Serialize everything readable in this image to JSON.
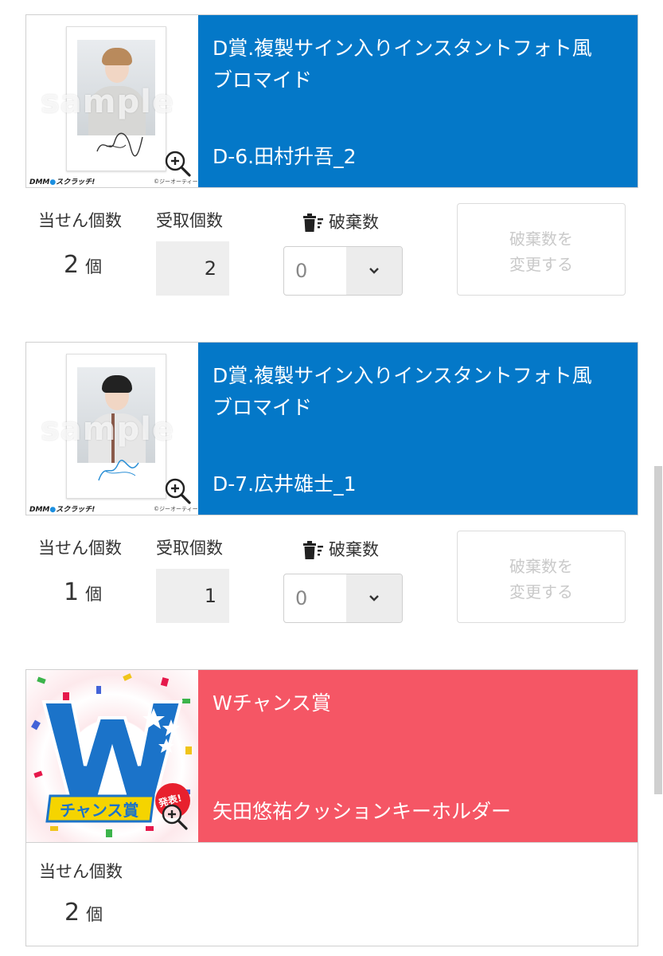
{
  "prizes": [
    {
      "title": "D賞.複製サイン入りインスタントフォト風\nブロマイド",
      "item": "D-6.田村升吾_2",
      "watermark": "sample",
      "logo_prefix": "DMM",
      "logo_brand": "スクラッチ!",
      "copyright": "©ジーオーティー",
      "won_label": "当せん個数",
      "won_value": "2",
      "unit": "個",
      "received_label": "受取個数",
      "received_value": "2",
      "discard_label": "破棄数",
      "discard_value": "0",
      "discard_button": "破棄数を\n変更する"
    },
    {
      "title": "D賞.複製サイン入りインスタントフォト風\nブロマイド",
      "item": "D-7.広井雄士_1",
      "watermark": "sample",
      "logo_prefix": "DMM",
      "logo_brand": "スクラッチ!",
      "copyright": "©ジーオーティー",
      "won_label": "当せん個数",
      "won_value": "1",
      "unit": "個",
      "received_label": "受取個数",
      "received_value": "1",
      "discard_label": "破棄数",
      "discard_value": "0",
      "discard_button": "破棄数を\n変更する"
    }
  ],
  "w_chance": {
    "title": "Wチャンス賞",
    "item": "矢田悠祐クッションキーホルダー",
    "banner_big": "W",
    "banner_label": "チャンス賞",
    "badge": "発表!",
    "won_label": "当せん個数",
    "won_value": "2",
    "unit": "個"
  },
  "colors": {
    "blue": "#0478c8",
    "red": "#f55665"
  }
}
